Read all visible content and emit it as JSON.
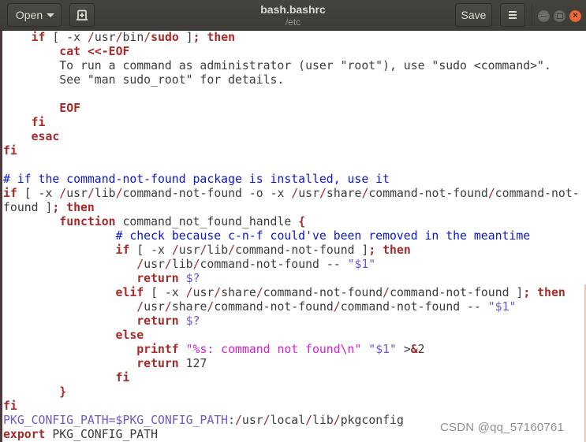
{
  "window": {
    "title": "bash.bashrc",
    "subtitle": "/etc",
    "open_label": "Open",
    "save_label": "Save"
  },
  "colors": {
    "keyword": "#a52a2a",
    "comment": "#0d17c4",
    "variable": "#6a5acd",
    "string": "#d41ed4",
    "text": "#3c3c3c",
    "headerbar": "#3c3b37",
    "close_button": "#e0531f"
  },
  "editor": {
    "lines": [
      [
        [
          "txt",
          "    "
        ],
        [
          "kw",
          "if"
        ],
        [
          "txt",
          " [ -x "
        ],
        [
          "path",
          "/"
        ],
        [
          "txt",
          "usr"
        ],
        [
          "path",
          "/"
        ],
        [
          "txt",
          "bin"
        ],
        [
          "path",
          "/"
        ],
        [
          "kw",
          "sudo"
        ],
        [
          "txt",
          " ]"
        ],
        [
          "kw",
          "; then"
        ]
      ],
      [
        [
          "txt",
          "        "
        ],
        [
          "kw",
          "cat"
        ],
        [
          "txt",
          " "
        ],
        [
          "kw",
          "<<-EOF"
        ]
      ],
      [
        [
          "txt",
          "        To run a command as administrator (user \"root\"), use \"sudo <command>\"."
        ]
      ],
      [
        [
          "txt",
          "        See \"man sudo_root\" for details."
        ]
      ],
      [
        [
          "txt",
          ""
        ]
      ],
      [
        [
          "txt",
          "        "
        ],
        [
          "kw",
          "EOF"
        ]
      ],
      [
        [
          "txt",
          "    "
        ],
        [
          "kw",
          "fi"
        ]
      ],
      [
        [
          "txt",
          "    "
        ],
        [
          "kw",
          "esac"
        ]
      ],
      [
        [
          "kw",
          "fi"
        ]
      ],
      [
        [
          "txt",
          ""
        ]
      ],
      [
        [
          "cm",
          "# if the command-not-found package is installed, use it"
        ]
      ],
      [
        [
          "kw",
          "if"
        ],
        [
          "txt",
          " [ -x "
        ],
        [
          "path",
          "/"
        ],
        [
          "txt",
          "usr"
        ],
        [
          "path",
          "/"
        ],
        [
          "txt",
          "lib"
        ],
        [
          "path",
          "/"
        ],
        [
          "txt",
          "command-not-found -o -x "
        ],
        [
          "path",
          "/"
        ],
        [
          "txt",
          "usr"
        ],
        [
          "path",
          "/"
        ],
        [
          "txt",
          "share"
        ],
        [
          "path",
          "/"
        ],
        [
          "txt",
          "command-not-found"
        ],
        [
          "path",
          "/"
        ],
        [
          "txt",
          "command-not-"
        ]
      ],
      [
        [
          "txt",
          "found ]"
        ],
        [
          "kw",
          "; then"
        ]
      ],
      [
        [
          "txt",
          "        "
        ],
        [
          "kw",
          "function"
        ],
        [
          "txt",
          " command_not_found_handle "
        ],
        [
          "kw",
          "{"
        ]
      ],
      [
        [
          "txt",
          "                "
        ],
        [
          "cm",
          "# check because c-n-f could've been removed in the meantime"
        ]
      ],
      [
        [
          "txt",
          "                "
        ],
        [
          "kw",
          "if"
        ],
        [
          "txt",
          " [ -x "
        ],
        [
          "path",
          "/"
        ],
        [
          "txt",
          "usr"
        ],
        [
          "path",
          "/"
        ],
        [
          "txt",
          "lib"
        ],
        [
          "path",
          "/"
        ],
        [
          "txt",
          "command-not-found ]"
        ],
        [
          "kw",
          "; then"
        ]
      ],
      [
        [
          "txt",
          "                   "
        ],
        [
          "path",
          "/"
        ],
        [
          "txt",
          "usr"
        ],
        [
          "path",
          "/"
        ],
        [
          "txt",
          "lib"
        ],
        [
          "path",
          "/"
        ],
        [
          "txt",
          "command-not-found -- "
        ],
        [
          "var",
          "\"$1\""
        ]
      ],
      [
        [
          "txt",
          "                   "
        ],
        [
          "kw",
          "return"
        ],
        [
          "txt",
          " "
        ],
        [
          "var",
          "$?"
        ]
      ],
      [
        [
          "txt",
          "                "
        ],
        [
          "kw",
          "elif"
        ],
        [
          "txt",
          " [ -x "
        ],
        [
          "path",
          "/"
        ],
        [
          "txt",
          "usr"
        ],
        [
          "path",
          "/"
        ],
        [
          "txt",
          "share"
        ],
        [
          "path",
          "/"
        ],
        [
          "txt",
          "command-not-found"
        ],
        [
          "path",
          "/"
        ],
        [
          "txt",
          "command-not-found ]"
        ],
        [
          "kw",
          "; then"
        ]
      ],
      [
        [
          "txt",
          "                   "
        ],
        [
          "path",
          "/"
        ],
        [
          "txt",
          "usr"
        ],
        [
          "path",
          "/"
        ],
        [
          "txt",
          "share"
        ],
        [
          "path",
          "/"
        ],
        [
          "txt",
          "command-not-found"
        ],
        [
          "path",
          "/"
        ],
        [
          "txt",
          "command-not-found -- "
        ],
        [
          "var",
          "\"$1\""
        ]
      ],
      [
        [
          "txt",
          "                   "
        ],
        [
          "kw",
          "return"
        ],
        [
          "txt",
          " "
        ],
        [
          "var",
          "$?"
        ]
      ],
      [
        [
          "txt",
          "                "
        ],
        [
          "kw",
          "else"
        ]
      ],
      [
        [
          "txt",
          "                   "
        ],
        [
          "kw",
          "printf"
        ],
        [
          "txt",
          " "
        ],
        [
          "str",
          "\"%s: command not found\\n\""
        ],
        [
          "txt",
          " "
        ],
        [
          "var",
          "\"$1\""
        ],
        [
          "txt",
          " >"
        ],
        [
          "kw",
          "&"
        ],
        [
          "txt",
          "2"
        ]
      ],
      [
        [
          "txt",
          "                   "
        ],
        [
          "kw",
          "return"
        ],
        [
          "txt",
          " 127"
        ]
      ],
      [
        [
          "txt",
          "                "
        ],
        [
          "kw",
          "fi"
        ]
      ],
      [
        [
          "txt",
          "        "
        ],
        [
          "kw",
          "}"
        ]
      ],
      [
        [
          "kw",
          "fi"
        ]
      ],
      [
        [
          "var",
          "PKG_CONFIG_PATH=$PKG_CONFIG_PATH"
        ],
        [
          "txt",
          ":"
        ],
        [
          "path",
          "/"
        ],
        [
          "txt",
          "usr"
        ],
        [
          "path",
          "/"
        ],
        [
          "txt",
          "local"
        ],
        [
          "path",
          "/"
        ],
        [
          "txt",
          "lib"
        ],
        [
          "path",
          "/"
        ],
        [
          "txt",
          "pkgconfig"
        ]
      ],
      [
        [
          "kw",
          "export"
        ],
        [
          "txt",
          " PKG_CONFIG_PATH"
        ]
      ]
    ]
  },
  "watermark": "CSDN @qq_57160761"
}
